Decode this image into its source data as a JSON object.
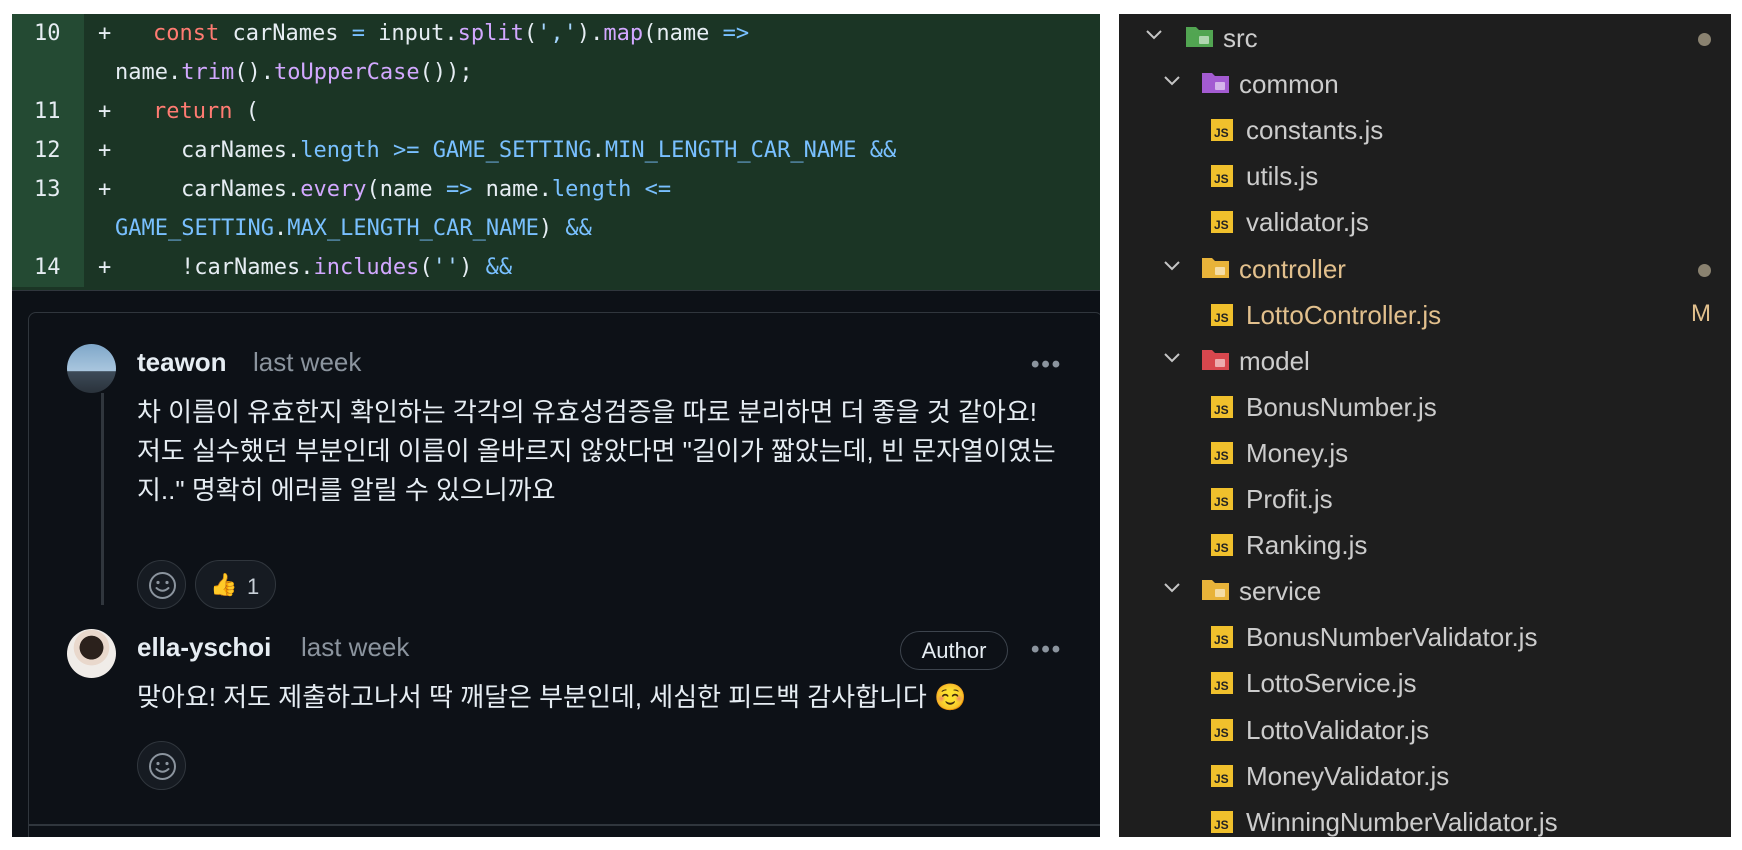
{
  "diff": {
    "lines": [
      {
        "num": "10",
        "sign": "+"
      },
      {
        "num": "11",
        "sign": "+"
      },
      {
        "num": "12",
        "sign": "+"
      },
      {
        "num": "13",
        "sign": "+"
      },
      {
        "num": "14",
        "sign": "+"
      }
    ],
    "tokens": {
      "l10_a": "const",
      "l10_b": " carNames ",
      "l10_c": "=",
      "l10_d": " input.",
      "l10_e": "split",
      "l10_f": "(",
      "l10_g": "','",
      "l10_h": ").",
      "l10_i": "map",
      "l10_j": "(name ",
      "l10_k": "=>",
      "l10w_a": "name.",
      "l10w_b": "trim",
      "l10w_c": "().",
      "l10w_d": "toUpperCase",
      "l10w_e": "());",
      "l11_a": "return",
      "l11_b": " (",
      "l12_a": "carNames.",
      "l12_b": "length",
      "l12_c": " >= ",
      "l12_d": "GAME_SETTING",
      "l12_e": ".",
      "l12_f": "MIN_LENGTH_CAR_NAME",
      "l12_g": " &&",
      "l13_a": "carNames.",
      "l13_b": "every",
      "l13_c": "(name ",
      "l13_d": "=>",
      "l13_e": " name.",
      "l13_f": "length",
      "l13_g": " <=",
      "l13w_a": "GAME_SETTING",
      "l13w_b": ".",
      "l13w_c": "MAX_LENGTH_CAR_NAME",
      "l13w_d": ") ",
      "l13w_e": "&&",
      "l14_a": "!carNames.",
      "l14_b": "includes",
      "l14_c": "(",
      "l14_d": "''",
      "l14_e": ") ",
      "l14_f": "&&"
    }
  },
  "comments": [
    {
      "author": "teawon",
      "time": "last week",
      "body_lines": [
        "차 이름이 유효한지 확인하는 각각의 유효성검증을 따로 분리하면 더 좋을 것 같아요!",
        "저도 실수했던 부분인데 이름이 올바르지 않았다면 \"길이가 짧았는데, 빈 문자열이였는",
        "지..\" 명확히 에러를 알릴 수 있으니까요"
      ],
      "reaction": {
        "emoji": "👍",
        "count": "1"
      }
    },
    {
      "author": "ella-yschoi",
      "time": "last week",
      "badge": "Author",
      "body_lines": [
        "맞아요! 저도 제출하고나서 딱 깨달은 부분인데, 세심한 피드백 감사합니다 ☺️"
      ]
    }
  ],
  "more_glyph": "•••",
  "explorer": {
    "items": [
      {
        "label": "src",
        "kind": "folder",
        "icon": "src-folder-icon",
        "depth": 0,
        "dot": true
      },
      {
        "label": "common",
        "kind": "folder",
        "icon": "common-folder-icon",
        "depth": 1
      },
      {
        "label": "constants.js",
        "kind": "file",
        "depth": 2
      },
      {
        "label": "utils.js",
        "kind": "file",
        "depth": 2
      },
      {
        "label": "validator.js",
        "kind": "file",
        "depth": 2
      },
      {
        "label": "controller",
        "kind": "folder",
        "icon": "controller-folder-icon",
        "depth": 1,
        "modified": true,
        "dot": true
      },
      {
        "label": "LottoController.js",
        "kind": "file",
        "depth": 2,
        "modified": true,
        "mark": "M"
      },
      {
        "label": "model",
        "kind": "folder",
        "icon": "model-folder-icon",
        "depth": 1
      },
      {
        "label": "BonusNumber.js",
        "kind": "file",
        "depth": 2
      },
      {
        "label": "Money.js",
        "kind": "file",
        "depth": 2
      },
      {
        "label": "Profit.js",
        "kind": "file",
        "depth": 2
      },
      {
        "label": "Ranking.js",
        "kind": "file",
        "depth": 2
      },
      {
        "label": "service",
        "kind": "folder",
        "icon": "service-folder-icon",
        "depth": 1
      },
      {
        "label": "BonusNumberValidator.js",
        "kind": "file",
        "depth": 2
      },
      {
        "label": "LottoService.js",
        "kind": "file",
        "depth": 2
      },
      {
        "label": "LottoValidator.js",
        "kind": "file",
        "depth": 2
      },
      {
        "label": "MoneyValidator.js",
        "kind": "file",
        "depth": 2
      },
      {
        "label": "WinningNumberValidator.js",
        "kind": "file",
        "depth": 2
      }
    ],
    "js_badge": "JS"
  },
  "colors": {
    "diff_bg": "#1b3525",
    "diff_gutter": "#244a33",
    "thread_bg": "#0d1117",
    "explorer_bg": "#1e1e1e",
    "modified": "#e2c08d",
    "js_icon": "#f0c02c"
  }
}
